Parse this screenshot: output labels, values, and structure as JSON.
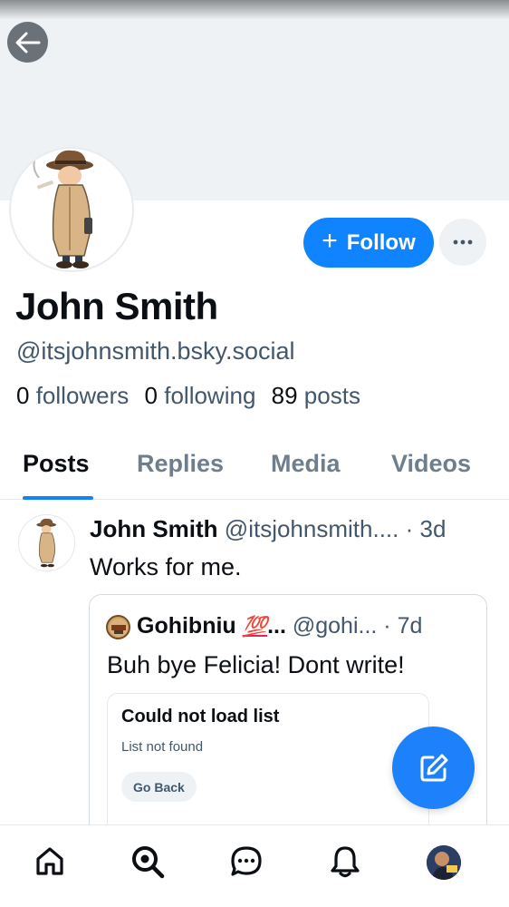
{
  "profile": {
    "display_name": "John Smith",
    "handle": "@itsjohnsmith.bsky.social",
    "followers_count": "0",
    "followers_label": "followers",
    "following_count": "0",
    "following_label": "following",
    "posts_count": "89",
    "posts_label": "posts",
    "follow_label": "Follow",
    "follow_plus": "+",
    "more_label": "···"
  },
  "tabs": [
    {
      "label": "Posts",
      "active": true
    },
    {
      "label": "Replies",
      "active": false
    },
    {
      "label": "Media",
      "active": false
    },
    {
      "label": "Videos",
      "active": false
    }
  ],
  "post": {
    "author_name": "John Smith",
    "author_handle": "@itsjohnsmith....",
    "separator": "·",
    "age": "3d",
    "text": "Works for me.",
    "quote": {
      "author_name": "Gohibniu",
      "author_emoji": "💯",
      "author_ellipsis": "...",
      "author_handle": "@gohi...",
      "separator": "·",
      "age": "7d",
      "text": "Buh bye Felicia! Dont write!",
      "embed": {
        "title": "Could not load list",
        "subtitle": "List not found",
        "button_label": "Go Back"
      }
    }
  },
  "icons": {
    "back": "arrow-left-icon",
    "more": "ellipsis-icon",
    "compose": "compose-icon",
    "nav": [
      "home-icon",
      "search-icon",
      "chat-icon",
      "bell-icon",
      "profile-avatar"
    ]
  },
  "colors": {
    "accent": "#1083fe",
    "banner": "#eef2f4",
    "text_primary": "#0b0f14",
    "text_secondary": "#42576c"
  }
}
